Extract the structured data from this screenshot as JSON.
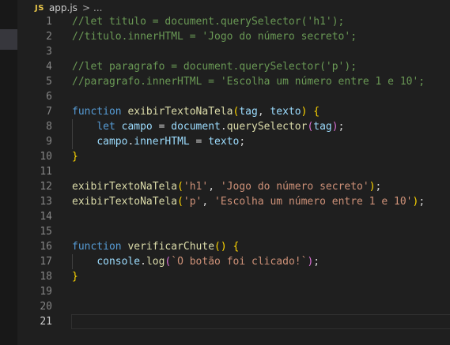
{
  "breadcrumb": {
    "language_badge": "JS",
    "file": "app.js",
    "separator": ">",
    "more": "..."
  },
  "editor": {
    "active_line": 21,
    "lines": [
      {
        "n": "1",
        "tokens": [
          {
            "c": "cm",
            "t": "//let titulo = document.querySelector('h1');"
          }
        ]
      },
      {
        "n": "2",
        "tokens": [
          {
            "c": "cm",
            "t": "//titulo.innerHTML = 'Jogo do número secreto';"
          }
        ]
      },
      {
        "n": "3",
        "tokens": []
      },
      {
        "n": "4",
        "tokens": [
          {
            "c": "cm",
            "t": "//let paragrafo = document.querySelector('p');"
          }
        ]
      },
      {
        "n": "5",
        "tokens": [
          {
            "c": "cm",
            "t": "//paragrafo.innerHTML = 'Escolha um número entre 1 e 10';"
          }
        ]
      },
      {
        "n": "6",
        "tokens": []
      },
      {
        "n": "7",
        "tokens": [
          {
            "c": "kw",
            "t": "function"
          },
          {
            "c": "df",
            "t": " "
          },
          {
            "c": "fn",
            "t": "exibirTextoNaTela"
          },
          {
            "c": "p1",
            "t": "("
          },
          {
            "c": "vr",
            "t": "tag"
          },
          {
            "c": "df",
            "t": ", "
          },
          {
            "c": "vr",
            "t": "texto"
          },
          {
            "c": "p1",
            "t": ")"
          },
          {
            "c": "df",
            "t": " "
          },
          {
            "c": "p1",
            "t": "{"
          }
        ]
      },
      {
        "n": "8",
        "tokens": [
          {
            "c": "df",
            "t": "    "
          },
          {
            "c": "kw",
            "t": "let"
          },
          {
            "c": "df",
            "t": " "
          },
          {
            "c": "vr",
            "t": "campo"
          },
          {
            "c": "df",
            "t": " = "
          },
          {
            "c": "vr",
            "t": "document"
          },
          {
            "c": "df",
            "t": "."
          },
          {
            "c": "fn",
            "t": "querySelector"
          },
          {
            "c": "p2",
            "t": "("
          },
          {
            "c": "vr",
            "t": "tag"
          },
          {
            "c": "p2",
            "t": ")"
          },
          {
            "c": "df",
            "t": ";"
          }
        ]
      },
      {
        "n": "9",
        "tokens": [
          {
            "c": "df",
            "t": "    "
          },
          {
            "c": "vr",
            "t": "campo"
          },
          {
            "c": "df",
            "t": "."
          },
          {
            "c": "vr",
            "t": "innerHTML"
          },
          {
            "c": "df",
            "t": " = "
          },
          {
            "c": "vr",
            "t": "texto"
          },
          {
            "c": "df",
            "t": ";"
          }
        ]
      },
      {
        "n": "10",
        "tokens": [
          {
            "c": "p1",
            "t": "}"
          }
        ]
      },
      {
        "n": "11",
        "tokens": []
      },
      {
        "n": "12",
        "tokens": [
          {
            "c": "fn",
            "t": "exibirTextoNaTela"
          },
          {
            "c": "p1",
            "t": "("
          },
          {
            "c": "st",
            "t": "'h1'"
          },
          {
            "c": "df",
            "t": ", "
          },
          {
            "c": "st",
            "t": "'Jogo do número secreto'"
          },
          {
            "c": "p1",
            "t": ")"
          },
          {
            "c": "df",
            "t": ";"
          }
        ]
      },
      {
        "n": "13",
        "tokens": [
          {
            "c": "fn",
            "t": "exibirTextoNaTela"
          },
          {
            "c": "p1",
            "t": "("
          },
          {
            "c": "st",
            "t": "'p'"
          },
          {
            "c": "df",
            "t": ", "
          },
          {
            "c": "st",
            "t": "'Escolha um número entre 1 e 10'"
          },
          {
            "c": "p1",
            "t": ")"
          },
          {
            "c": "df",
            "t": ";"
          }
        ]
      },
      {
        "n": "14",
        "tokens": []
      },
      {
        "n": "15",
        "tokens": []
      },
      {
        "n": "16",
        "tokens": [
          {
            "c": "kw",
            "t": "function"
          },
          {
            "c": "df",
            "t": " "
          },
          {
            "c": "fn",
            "t": "verificarChute"
          },
          {
            "c": "p1",
            "t": "()"
          },
          {
            "c": "df",
            "t": " "
          },
          {
            "c": "p1",
            "t": "{"
          }
        ]
      },
      {
        "n": "17",
        "tokens": [
          {
            "c": "df",
            "t": "    "
          },
          {
            "c": "vr",
            "t": "console"
          },
          {
            "c": "df",
            "t": "."
          },
          {
            "c": "fn",
            "t": "log"
          },
          {
            "c": "p2",
            "t": "("
          },
          {
            "c": "st",
            "t": "`O botão foi clicado!`"
          },
          {
            "c": "p2",
            "t": ")"
          },
          {
            "c": "df",
            "t": ";"
          }
        ]
      },
      {
        "n": "18",
        "tokens": [
          {
            "c": "p1",
            "t": "}"
          }
        ]
      },
      {
        "n": "19",
        "tokens": []
      },
      {
        "n": "20",
        "tokens": []
      },
      {
        "n": "21",
        "tokens": []
      }
    ]
  }
}
